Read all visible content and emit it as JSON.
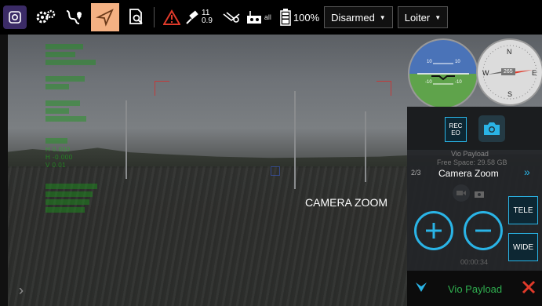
{
  "toolbar": {
    "gps_count": "11",
    "gps_hdop": "0.9",
    "rc_label": "all",
    "battery": "100%",
    "arm_mode": "Disarmed",
    "flight_mode": "Loiter"
  },
  "hud": {
    "center_label": "CAMERA ZOOM",
    "left_texts": [
      "H 0.000",
      "H -0.000",
      "V 0.01"
    ]
  },
  "instruments": {
    "attitude_marks": [
      "10",
      "10",
      "-10",
      "-10"
    ],
    "compass_letters": {
      "n": "N",
      "e": "E",
      "s": "S",
      "w": "W"
    },
    "heading": "265"
  },
  "panel": {
    "rec_line1": "REC",
    "rec_line2": "EO",
    "payload_title": "Vio Payload",
    "free_space": "Free Space: 29.58 GB",
    "page": "2/3",
    "mode": "Camera Zoom",
    "next_icon": "»",
    "tele": "TELE",
    "wide": "WIDE",
    "timer": "00:00:34",
    "footer_title": "Vio Payload"
  },
  "colors": {
    "accent": "#2ab4e6",
    "warning": "#e03a2a",
    "reticle": "#c23a3a",
    "hud_green": "#18c418",
    "footer_text": "#2fae4f"
  }
}
